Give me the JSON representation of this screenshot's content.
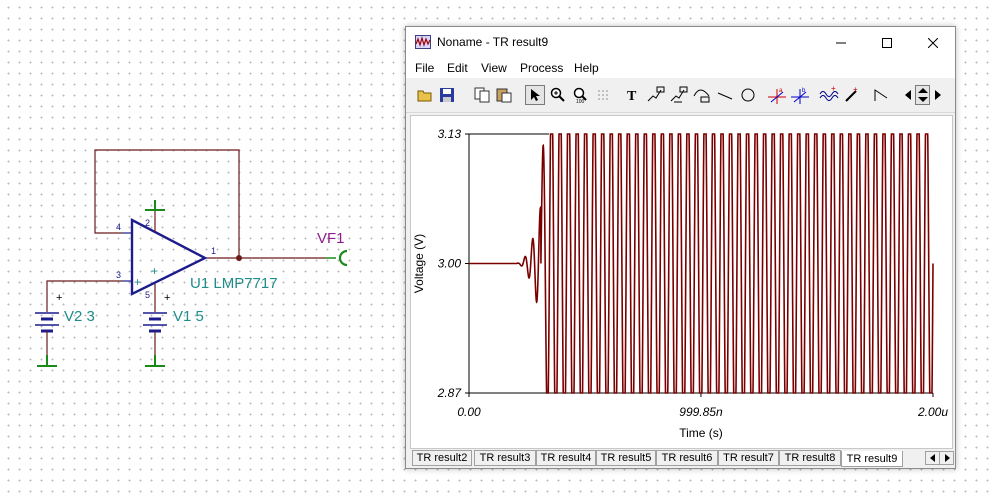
{
  "schematic": {
    "opamp": {
      "name": "U1",
      "part": "LMP7717",
      "pins": [
        "1",
        "2",
        "3",
        "4",
        "5"
      ],
      "plus_sign": "+",
      "minus_sign": "+"
    },
    "sources": [
      {
        "name": "V2",
        "value": "3",
        "sign": "+"
      },
      {
        "name": "V1",
        "value": "5",
        "sign": "+"
      }
    ],
    "probe": {
      "name": "VF1"
    },
    "colors": {
      "wire": "#6b1b1b",
      "ground": "#1a8a1a",
      "opamp": "#1c1c8c",
      "label": "#1e8c8c",
      "probe": "#8c1c8c"
    }
  },
  "window": {
    "title": "Noname - TR result9",
    "app_icon": "oscilloscope-icon",
    "controls": {
      "minimize": "minimize-icon",
      "maximize": "maximize-icon",
      "close": "close-icon"
    },
    "menu": [
      "File",
      "Edit",
      "View",
      "Process",
      "Help"
    ],
    "toolbar": [
      "open-folder-icon",
      "save-disk-icon",
      "copy-icon",
      "paste-icon",
      "pointer-icon",
      "zoom-in-icon",
      "zoom-100-icon",
      "grid-icon",
      "text-icon",
      "curve-label-icon",
      "curve-label-2-icon",
      "curve-label-3-icon",
      "line-icon",
      "circle-icon",
      "cursor-a-icon",
      "cursor-b-icon",
      "waveform-icon",
      "probe-pen-icon",
      "step-icon",
      "scroll-left-icon",
      "scroll-updown-icon",
      "scroll-right-icon"
    ],
    "tabs": [
      "TR result2",
      "TR result3",
      "TR result4",
      "TR result5",
      "TR result6",
      "TR result7",
      "TR result8",
      "TR result9"
    ],
    "active_tab": "TR result9"
  },
  "chart_data": {
    "type": "line",
    "xlabel": "Time (s)",
    "ylabel": "Voltage (V)",
    "x_ticks": [
      "0.00",
      "999.85n",
      "2.00u"
    ],
    "y_ticks": [
      "3.13",
      "3.00",
      "2.87"
    ],
    "xlim": [
      0,
      2e-06
    ],
    "ylim": [
      2.87,
      3.13
    ],
    "series": [
      {
        "color": "#7a0000",
        "description_points": {
          "baseline_value": 3.0,
          "ringing_start_s": 2e-07,
          "oscillation_start_s": 3.1e-07,
          "oscillation_min": 2.87,
          "oscillation_max": 3.13,
          "cycles_in_window": 46
        }
      }
    ]
  }
}
